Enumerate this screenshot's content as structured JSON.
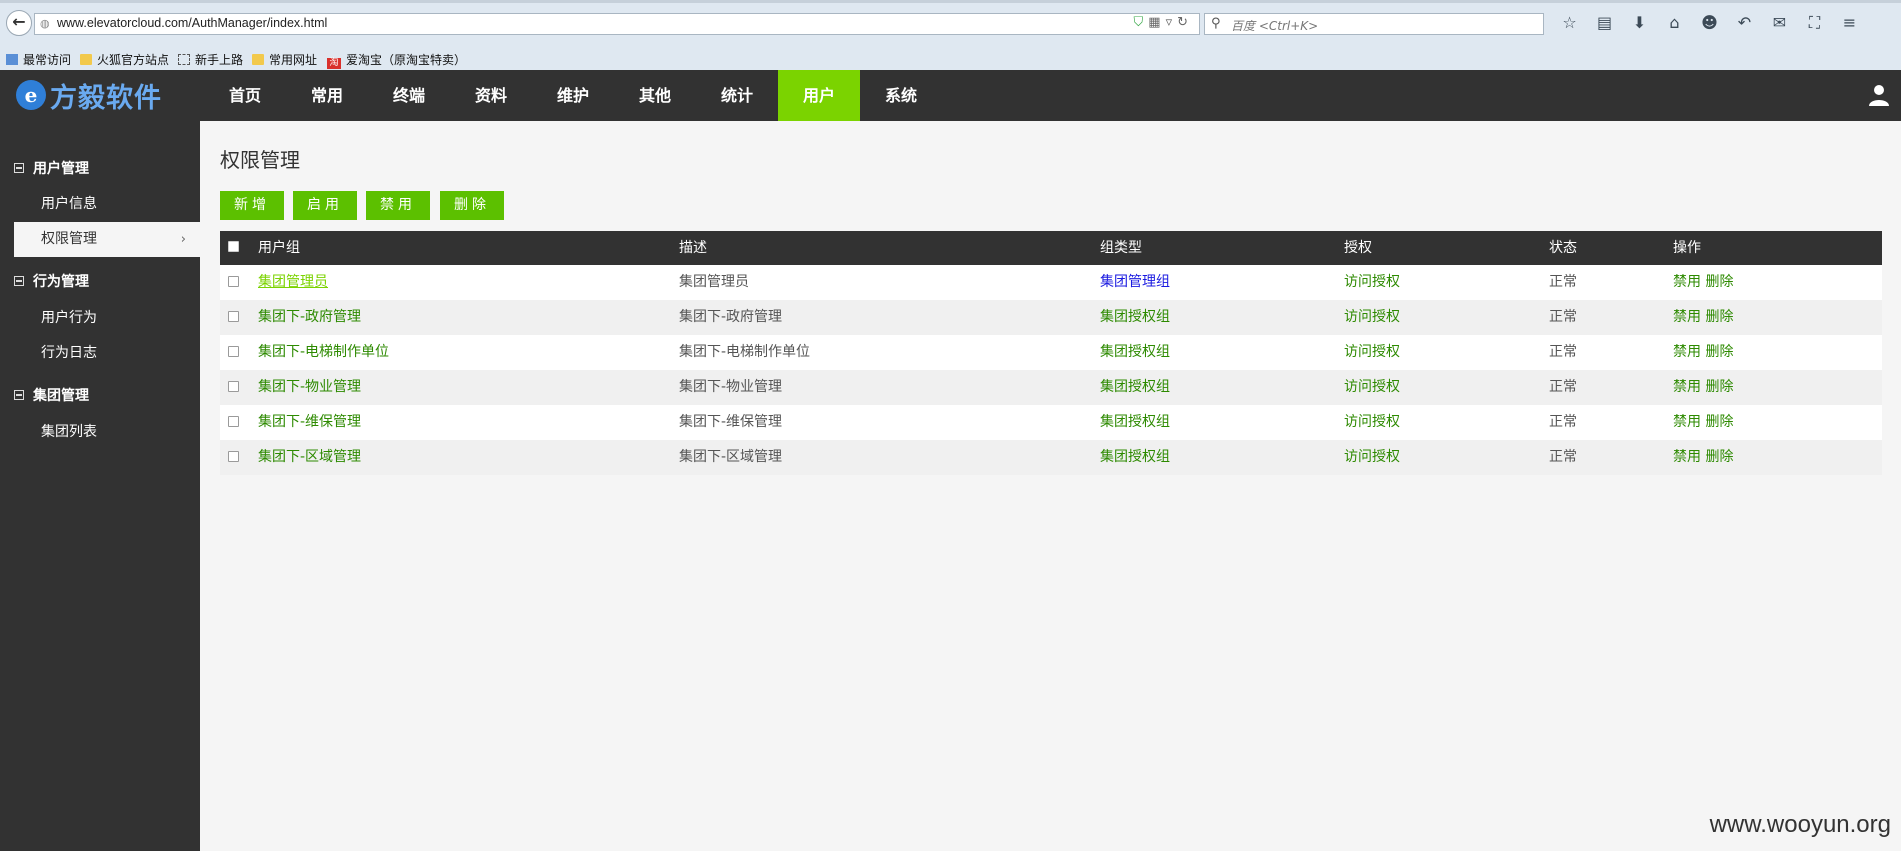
{
  "browser": {
    "url": "www.elevatorcloud.com/AuthManager/index.html",
    "search_placeholder": "百度 <Ctrl+K>",
    "bookmarks": [
      "最常访问",
      "火狐官方站点",
      "新手上路",
      "常用网址",
      "爱淘宝（原淘宝特卖）"
    ]
  },
  "header": {
    "logo_mark": "e",
    "logo_text": "方毅软件",
    "nav": [
      "首页",
      "常用",
      "终端",
      "资料",
      "维护",
      "其他",
      "统计",
      "用户",
      "系统"
    ],
    "active_nav": "用户"
  },
  "sidebar": {
    "groups": [
      {
        "label": "用户管理",
        "items": [
          "用户信息",
          "权限管理"
        ]
      },
      {
        "label": "行为管理",
        "items": [
          "用户行为",
          "行为日志"
        ]
      },
      {
        "label": "集团管理",
        "items": [
          "集团列表"
        ]
      }
    ],
    "active_item": "权限管理",
    "chevron": "›"
  },
  "main": {
    "title": "权限管理",
    "buttons": [
      "新增",
      "启用",
      "禁用",
      "删除"
    ],
    "columns": [
      "用户组",
      "描述",
      "组类型",
      "授权",
      "状态",
      "操作"
    ],
    "rows": [
      {
        "group": "集团管理员",
        "desc": "集团管理员",
        "type": "集团管理组",
        "auth": "访问授权",
        "status": "正常",
        "op_disable": "禁用",
        "op_delete": "删除"
      },
      {
        "group": "集团下-政府管理",
        "desc": "集团下-政府管理",
        "type": "集团授权组",
        "auth": "访问授权",
        "status": "正常",
        "op_disable": "禁用",
        "op_delete": "删除"
      },
      {
        "group": "集团下-电梯制作单位",
        "desc": "集团下-电梯制作单位",
        "type": "集团授权组",
        "auth": "访问授权",
        "status": "正常",
        "op_disable": "禁用",
        "op_delete": "删除"
      },
      {
        "group": "集团下-物业管理",
        "desc": "集团下-物业管理",
        "type": "集团授权组",
        "auth": "访问授权",
        "status": "正常",
        "op_disable": "禁用",
        "op_delete": "删除"
      },
      {
        "group": "集团下-维保管理",
        "desc": "集团下-维保管理",
        "type": "集团授权组",
        "auth": "访问授权",
        "status": "正常",
        "op_disable": "禁用",
        "op_delete": "删除"
      },
      {
        "group": "集团下-区域管理",
        "desc": "集团下-区域管理",
        "type": "集团授权组",
        "auth": "访问授权",
        "status": "正常",
        "op_disable": "禁用",
        "op_delete": "删除"
      }
    ]
  },
  "watermark": "www.wooyun.org",
  "colors": {
    "accent": "#7bd300",
    "button": "#5cc000",
    "dark": "#323232",
    "link": "#2d8a00",
    "link_blue": "#1a1ae0"
  }
}
